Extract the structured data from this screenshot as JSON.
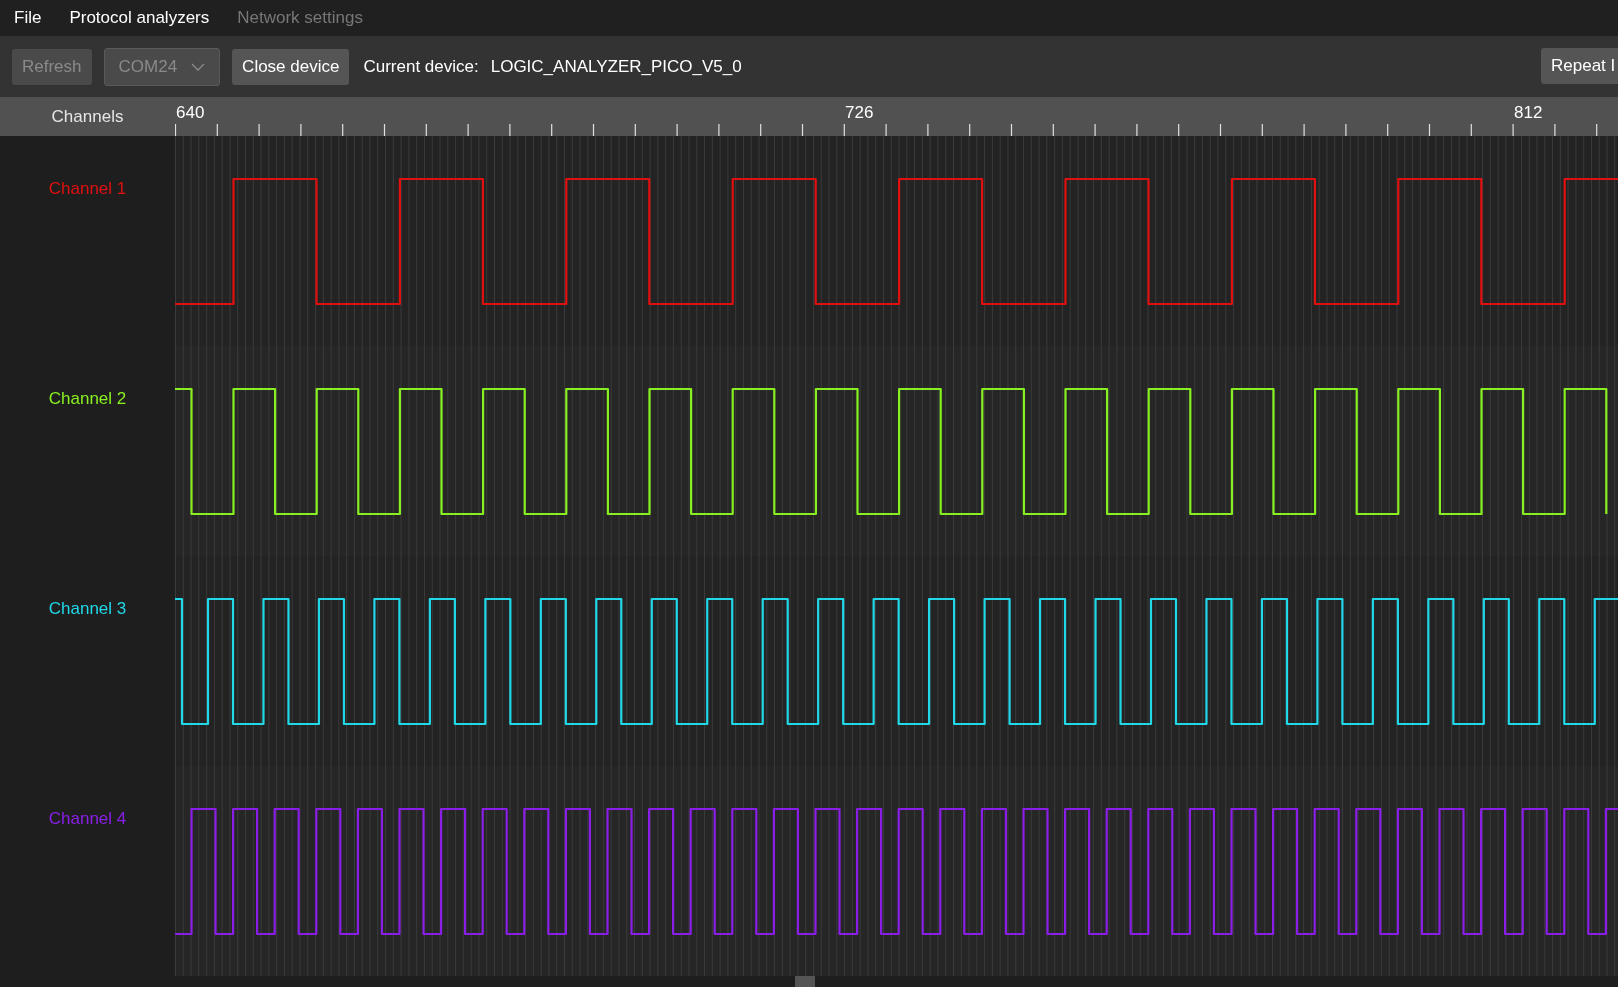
{
  "menu": [
    {
      "label": "File",
      "disabled": false
    },
    {
      "label": "Protocol analyzers",
      "disabled": false
    },
    {
      "label": "Network settings",
      "disabled": true
    }
  ],
  "toolbar": {
    "refresh": {
      "label": "Refresh",
      "disabled": true
    },
    "port_select": {
      "value": "COM24",
      "disabled": true
    },
    "close_button": {
      "label": "Close device",
      "disabled": false
    },
    "device_label": "Current device:",
    "device_name": "LOGIC_ANALYZER_PICO_V5_0",
    "repeat_button": {
      "label": "Repeat I",
      "disabled": false
    }
  },
  "ruler": {
    "heading": "Channels",
    "labels": [
      "640",
      "726",
      "812"
    ]
  },
  "channels": [
    {
      "name": "Channel 1",
      "color": "#e01010"
    },
    {
      "name": "Channel 2",
      "color": "#88f020"
    },
    {
      "name": "Channel 3",
      "color": "#20d8e8"
    },
    {
      "name": "Channel 4",
      "color": "#8a1ee8"
    }
  ]
}
